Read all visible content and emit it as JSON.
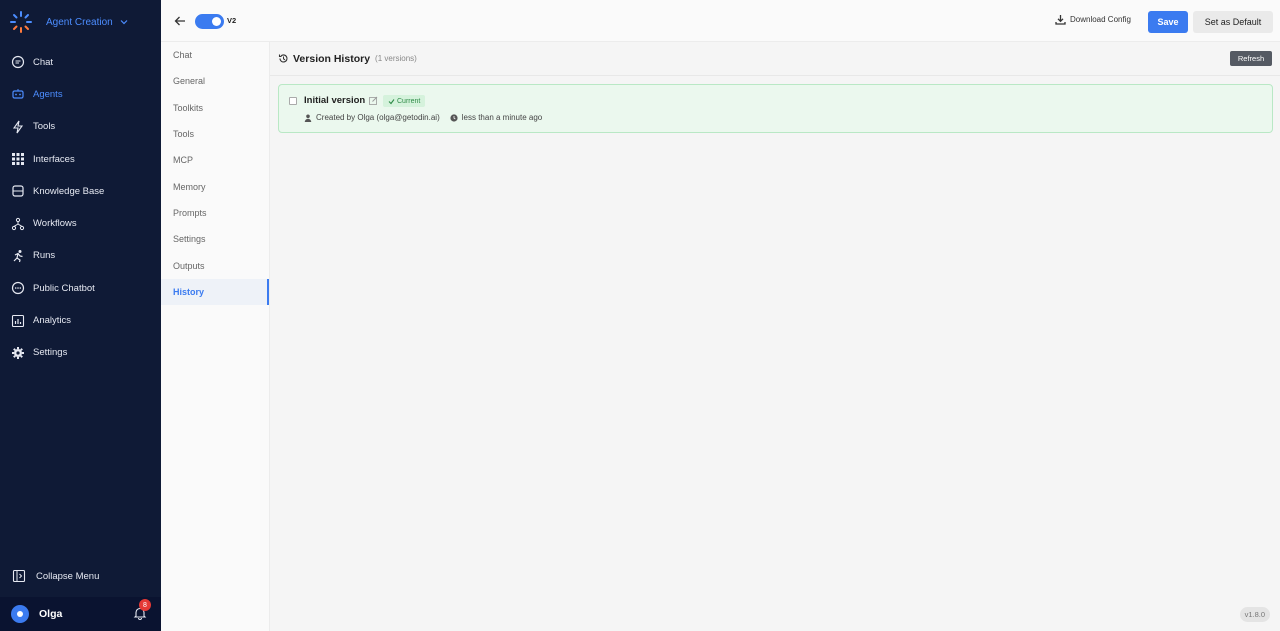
{
  "brand": {
    "name": "Agent Creation"
  },
  "nav": {
    "items": [
      {
        "label": "Chat",
        "icon": "chat-icon"
      },
      {
        "label": "Agents",
        "icon": "robot-icon",
        "active": true
      },
      {
        "label": "Tools",
        "icon": "bolt-icon"
      },
      {
        "label": "Interfaces",
        "icon": "grid-icon"
      },
      {
        "label": "Knowledge Base",
        "icon": "database-icon"
      },
      {
        "label": "Workflows",
        "icon": "workflow-icon"
      },
      {
        "label": "Runs",
        "icon": "runner-icon"
      },
      {
        "label": "Public Chatbot",
        "icon": "chat-dots-icon"
      },
      {
        "label": "Analytics",
        "icon": "analytics-icon"
      },
      {
        "label": "Settings",
        "icon": "gear-icon"
      }
    ],
    "collapse_label": "Collapse Menu"
  },
  "user": {
    "name": "Olga",
    "notifications": "8"
  },
  "header": {
    "toggle_label": "V2",
    "download_label": "Download Config",
    "save_label": "Save",
    "default_label": "Set as Default"
  },
  "subnav": {
    "items": [
      {
        "label": "Chat"
      },
      {
        "label": "General"
      },
      {
        "label": "Toolkits"
      },
      {
        "label": "Tools"
      },
      {
        "label": "MCP"
      },
      {
        "label": "Memory"
      },
      {
        "label": "Prompts"
      },
      {
        "label": "Settings"
      },
      {
        "label": "Outputs"
      },
      {
        "label": "History",
        "active": true
      }
    ]
  },
  "main": {
    "title": "Version History",
    "count": "(1 versions)",
    "refresh_label": "Refresh",
    "version": {
      "name": "Initial version",
      "badge": "Current",
      "created_by": "Created by Olga (olga@getodin.ai)",
      "time": "less than a minute ago"
    },
    "app_version": "v1.8.0"
  },
  "colors": {
    "accent": "#3b7bf0",
    "sidebar_bg": "#0f1a36",
    "card_bg": "#ebf8ee",
    "badge_green": "#2e8b47"
  }
}
